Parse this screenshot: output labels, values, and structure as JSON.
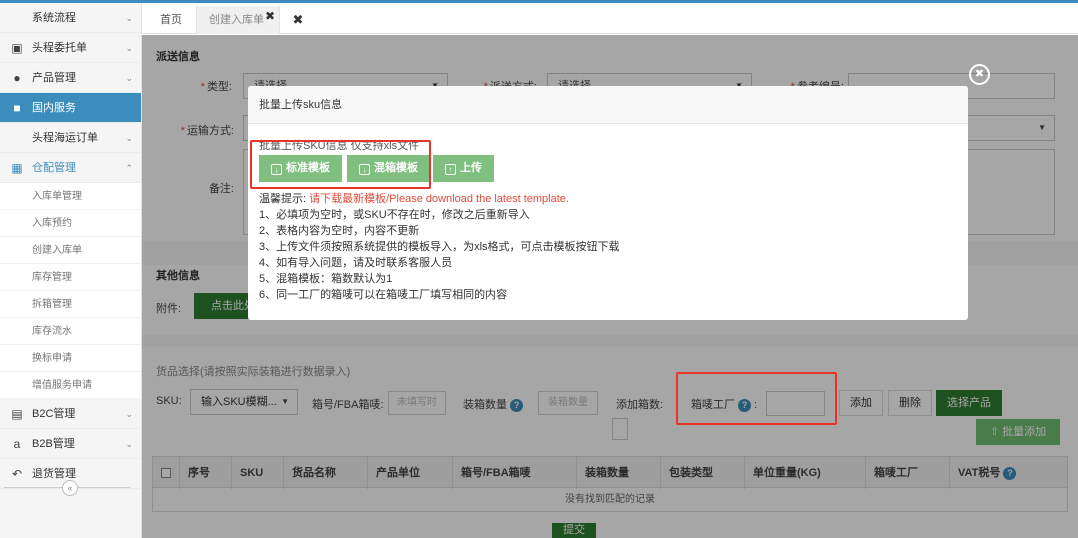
{
  "colors": {
    "primary": "#3c8dbc",
    "green": "#2e7d32",
    "light_green": "#7fbf7f",
    "required": "#e24b3b",
    "highlight": "#e8332a"
  },
  "sidebar": {
    "items": [
      {
        "label": "系统流程",
        "icon": "",
        "has_chevron": true
      },
      {
        "label": "头程委托单",
        "icon": "briefcase-icon",
        "has_chevron": true
      },
      {
        "label": "产品管理",
        "icon": "tag-icon",
        "has_chevron": true
      },
      {
        "label": "国内服务",
        "icon": "folder-icon",
        "has_chevron": false
      },
      {
        "label": "头程海运订单",
        "icon": "",
        "has_chevron": true
      },
      {
        "label": "仓配管理",
        "icon": "grid-icon",
        "has_chevron": true
      }
    ],
    "sub_items": [
      "入库单管理",
      "入库预约",
      "创建入库单",
      "库存管理",
      "拆箱管理",
      "库存流水",
      "换标申请",
      "增值服务申请"
    ],
    "bottom_items": [
      {
        "label": "B2C管理",
        "icon": "cart-icon"
      },
      {
        "label": "B2B管理",
        "icon": "amazon-icon"
      },
      {
        "label": "退货管理",
        "icon": "return-icon"
      }
    ]
  },
  "tabs": {
    "home": "首页",
    "create": "创建入库单"
  },
  "form": {
    "section_title": "派送信息",
    "type_label": "类型:",
    "type_value": "请选择",
    "delivery_label": "派送方式:",
    "delivery_value": "请选择",
    "ref_label": "参考编号:",
    "transport_label": "运输方式:",
    "remark_label": "备注:"
  },
  "other": {
    "section_title": "其他信息",
    "attach_label": "附件:",
    "attach_button": "点击此处上传"
  },
  "goods": {
    "section_title": "货品选择(请按照实际装箱进行数据录入)",
    "sku_label": "SKU:",
    "sku_select": "输入SKU模糊...",
    "box_label": "箱号/FBA箱唛:",
    "box_placeholder": "未填写时",
    "count_label": "装箱数量",
    "count_placeholder": "装箱数量",
    "add_box_label": "添加箱数:",
    "factory_label": "箱唛工厂",
    "add_button": "添加",
    "delete_button": "删除",
    "select_button": "选择产品",
    "batch_add_button": "批量添加"
  },
  "table": {
    "headers": [
      "序号",
      "SKU",
      "货品名称",
      "产品单位",
      "箱号/FBA箱唛",
      "装箱数量",
      "包装类型",
      "单位重量(KG)",
      "箱唛工厂",
      "VAT税号"
    ],
    "empty_text": "没有找到匹配的记录",
    "submit_button": "提交"
  },
  "modal": {
    "title": "批量上传sku信息",
    "subtitle": "批量上传SKU信息 仅支持xls文件",
    "btn_standard": "标准模板",
    "btn_mixed": "混箱模板",
    "btn_upload": "上传",
    "tip_prefix": "温馨提示:",
    "tip_red": "请下载最新模板/Please download the latest template.",
    "tips": [
      "1、必填项为空时，或SKU不存在时，修改之后重新导入",
      "2、表格内容为空时，内容不更新",
      "3、上传文件须按照系统提供的模板导入，为xls格式，可点击模板按钮下载",
      "4、如有导入问题，请及时联系客服人员",
      "5、混箱模板：箱数默认为1",
      "6、同一工厂的箱唛可以在箱唛工厂填写相同的内容"
    ]
  }
}
